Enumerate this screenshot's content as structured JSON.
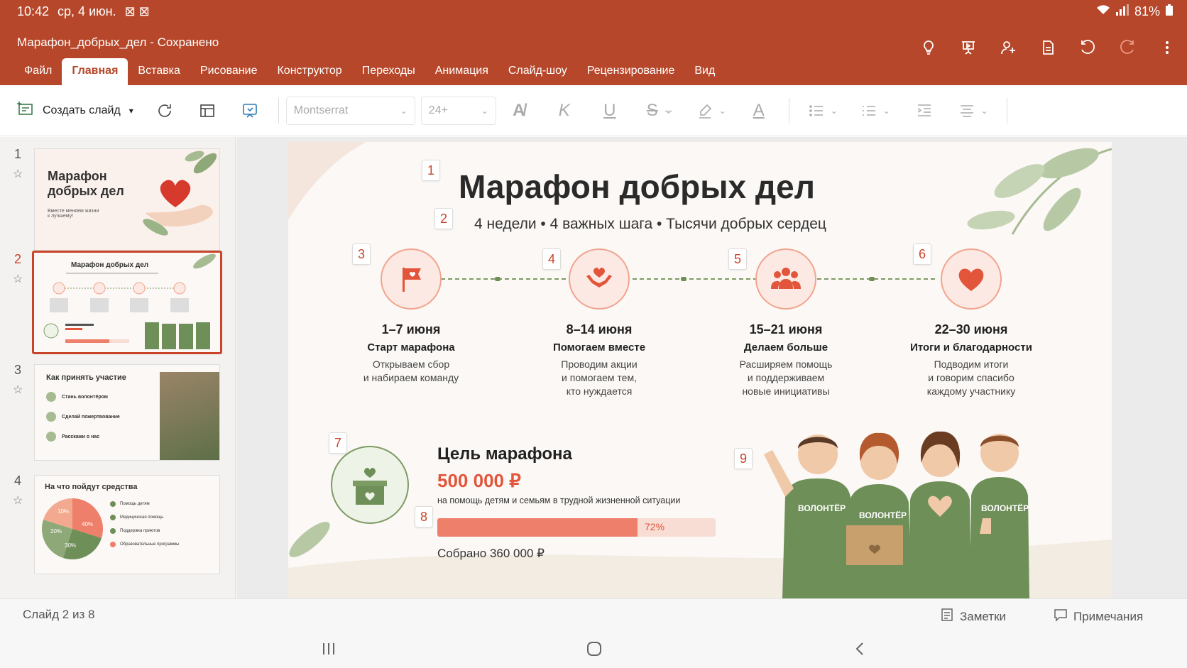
{
  "status": {
    "time": "10:42",
    "date": "ср, 4 июн.",
    "battery": "81%"
  },
  "document": {
    "title": "Марафон_добрых_дел - Сохранено"
  },
  "tabs": [
    {
      "label": "Файл"
    },
    {
      "label": "Главная"
    },
    {
      "label": "Вставка"
    },
    {
      "label": "Рисование"
    },
    {
      "label": "Конструктор"
    },
    {
      "label": "Переходы"
    },
    {
      "label": "Анимация"
    },
    {
      "label": "Слайд-шоу"
    },
    {
      "label": "Рецензирование"
    },
    {
      "label": "Вид"
    }
  ],
  "toolbar": {
    "new_slide_label": "Создать слайд",
    "font_name": "Montserrat",
    "font_size": "24+"
  },
  "thumbnails": [
    {
      "num": "1",
      "title": "Марафон\nдобрых дел",
      "text": "Вместе меняем жизни\nк лучшему!"
    },
    {
      "num": "2",
      "title": "Марафон добрых дел"
    },
    {
      "num": "3",
      "title": "Как принять участие",
      "items": [
        "Стань волонтёром",
        "Сделай пожертвование",
        "Расскажи о нас"
      ]
    },
    {
      "num": "4",
      "title": "На что пойдут средства",
      "items": [
        "Помощь детям",
        "Медицинская помощь",
        "Поддержка приютов",
        "Образовательные программы"
      ],
      "pie": [
        "10%",
        "40%",
        "20%",
        "30%"
      ]
    }
  ],
  "slide": {
    "title": "Марафон добрых дел",
    "subtitle": "4 недели • 4 важных шага • Тысячи добрых сердец",
    "tags": [
      "1",
      "2",
      "3",
      "4",
      "5",
      "6",
      "7",
      "8",
      "9"
    ],
    "steps": [
      {
        "date": "1–7 июня",
        "name": "Старт марафона",
        "desc": "Открываем сбор\nи набираем команду",
        "icon": "flag-heart-icon"
      },
      {
        "date": "8–14 июня",
        "name": "Помогаем вместе",
        "desc": "Проводим акции\nи помогаем тем,\nкто нуждается",
        "icon": "hands-heart-icon"
      },
      {
        "date": "15–21 июня",
        "name": "Делаем больше",
        "desc": "Расширяем помощь\nи поддерживаем\nновые инициативы",
        "icon": "people-group-icon"
      },
      {
        "date": "22–30 июня",
        "name": "Итоги и благодарности",
        "desc": "Подводим итоги\nи говорим спасибо\nкаждому участнику",
        "icon": "heart-icon"
      }
    ],
    "goal": {
      "title": "Цель марафона",
      "amount": "500 000 ₽",
      "description": "на помощь детям и семьям в трудной жизненной ситуации",
      "progress_percent": 72,
      "progress_label": "72%",
      "collected": "Собрано 360 000 ₽"
    },
    "volunteer_shirt": "ВОЛОНТЁР"
  },
  "footer": {
    "slide_counter": "Слайд 2 из 8",
    "notes_label": "Заметки",
    "comments_label": "Примечания"
  },
  "colors": {
    "accent": "#b7472a",
    "coral": "#ee7f6a",
    "green": "#6e8f58"
  }
}
